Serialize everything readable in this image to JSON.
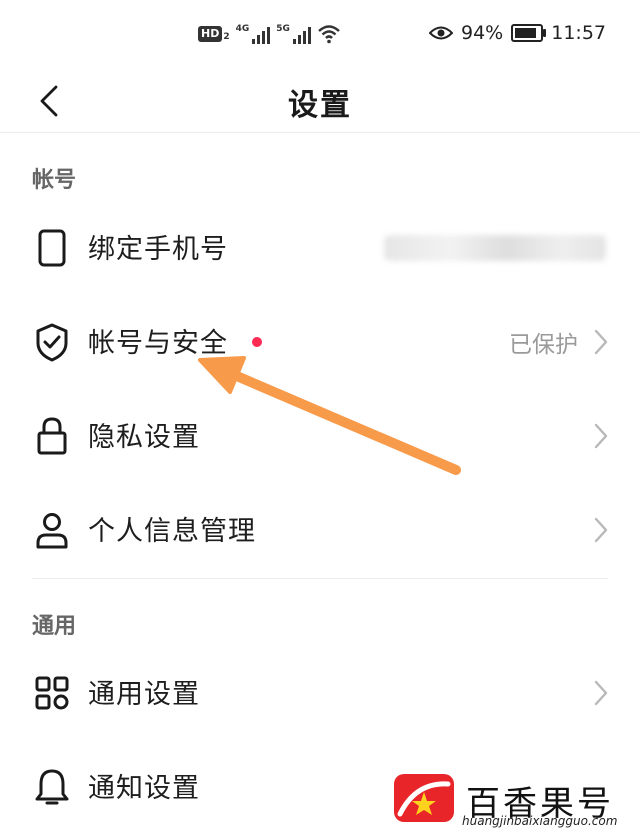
{
  "status_bar": {
    "network_badge": "HD",
    "network_badge_sub": "2",
    "sim1_label": "4G",
    "sim2_label": "5G",
    "battery_percent": "94%",
    "battery_level": 0.94,
    "time": "11:57"
  },
  "header": {
    "title": "设置",
    "back_icon": "chevron-left-icon"
  },
  "sections": {
    "account": {
      "title": "帐号",
      "items": [
        {
          "label": "绑定手机号",
          "icon": "phone-icon"
        },
        {
          "label": "帐号与安全",
          "icon": "shield-check-icon",
          "value": "已保护",
          "badge_color": "#fe2c55"
        },
        {
          "label": "隐私设置",
          "icon": "lock-icon"
        },
        {
          "label": "个人信息管理",
          "icon": "person-icon"
        }
      ]
    },
    "general": {
      "title": "通用",
      "items": [
        {
          "label": "通用设置",
          "icon": "grid-icon"
        },
        {
          "label": "通知设置",
          "icon": "bell-icon"
        }
      ]
    }
  },
  "annotation": {
    "arrow_color": "#f79a4a",
    "icon": "pointer-arrow-icon"
  },
  "watermark": {
    "brand": "百香果号",
    "url": "huangjinbaixiangguo.com",
    "logo_color": "#e8262a"
  }
}
